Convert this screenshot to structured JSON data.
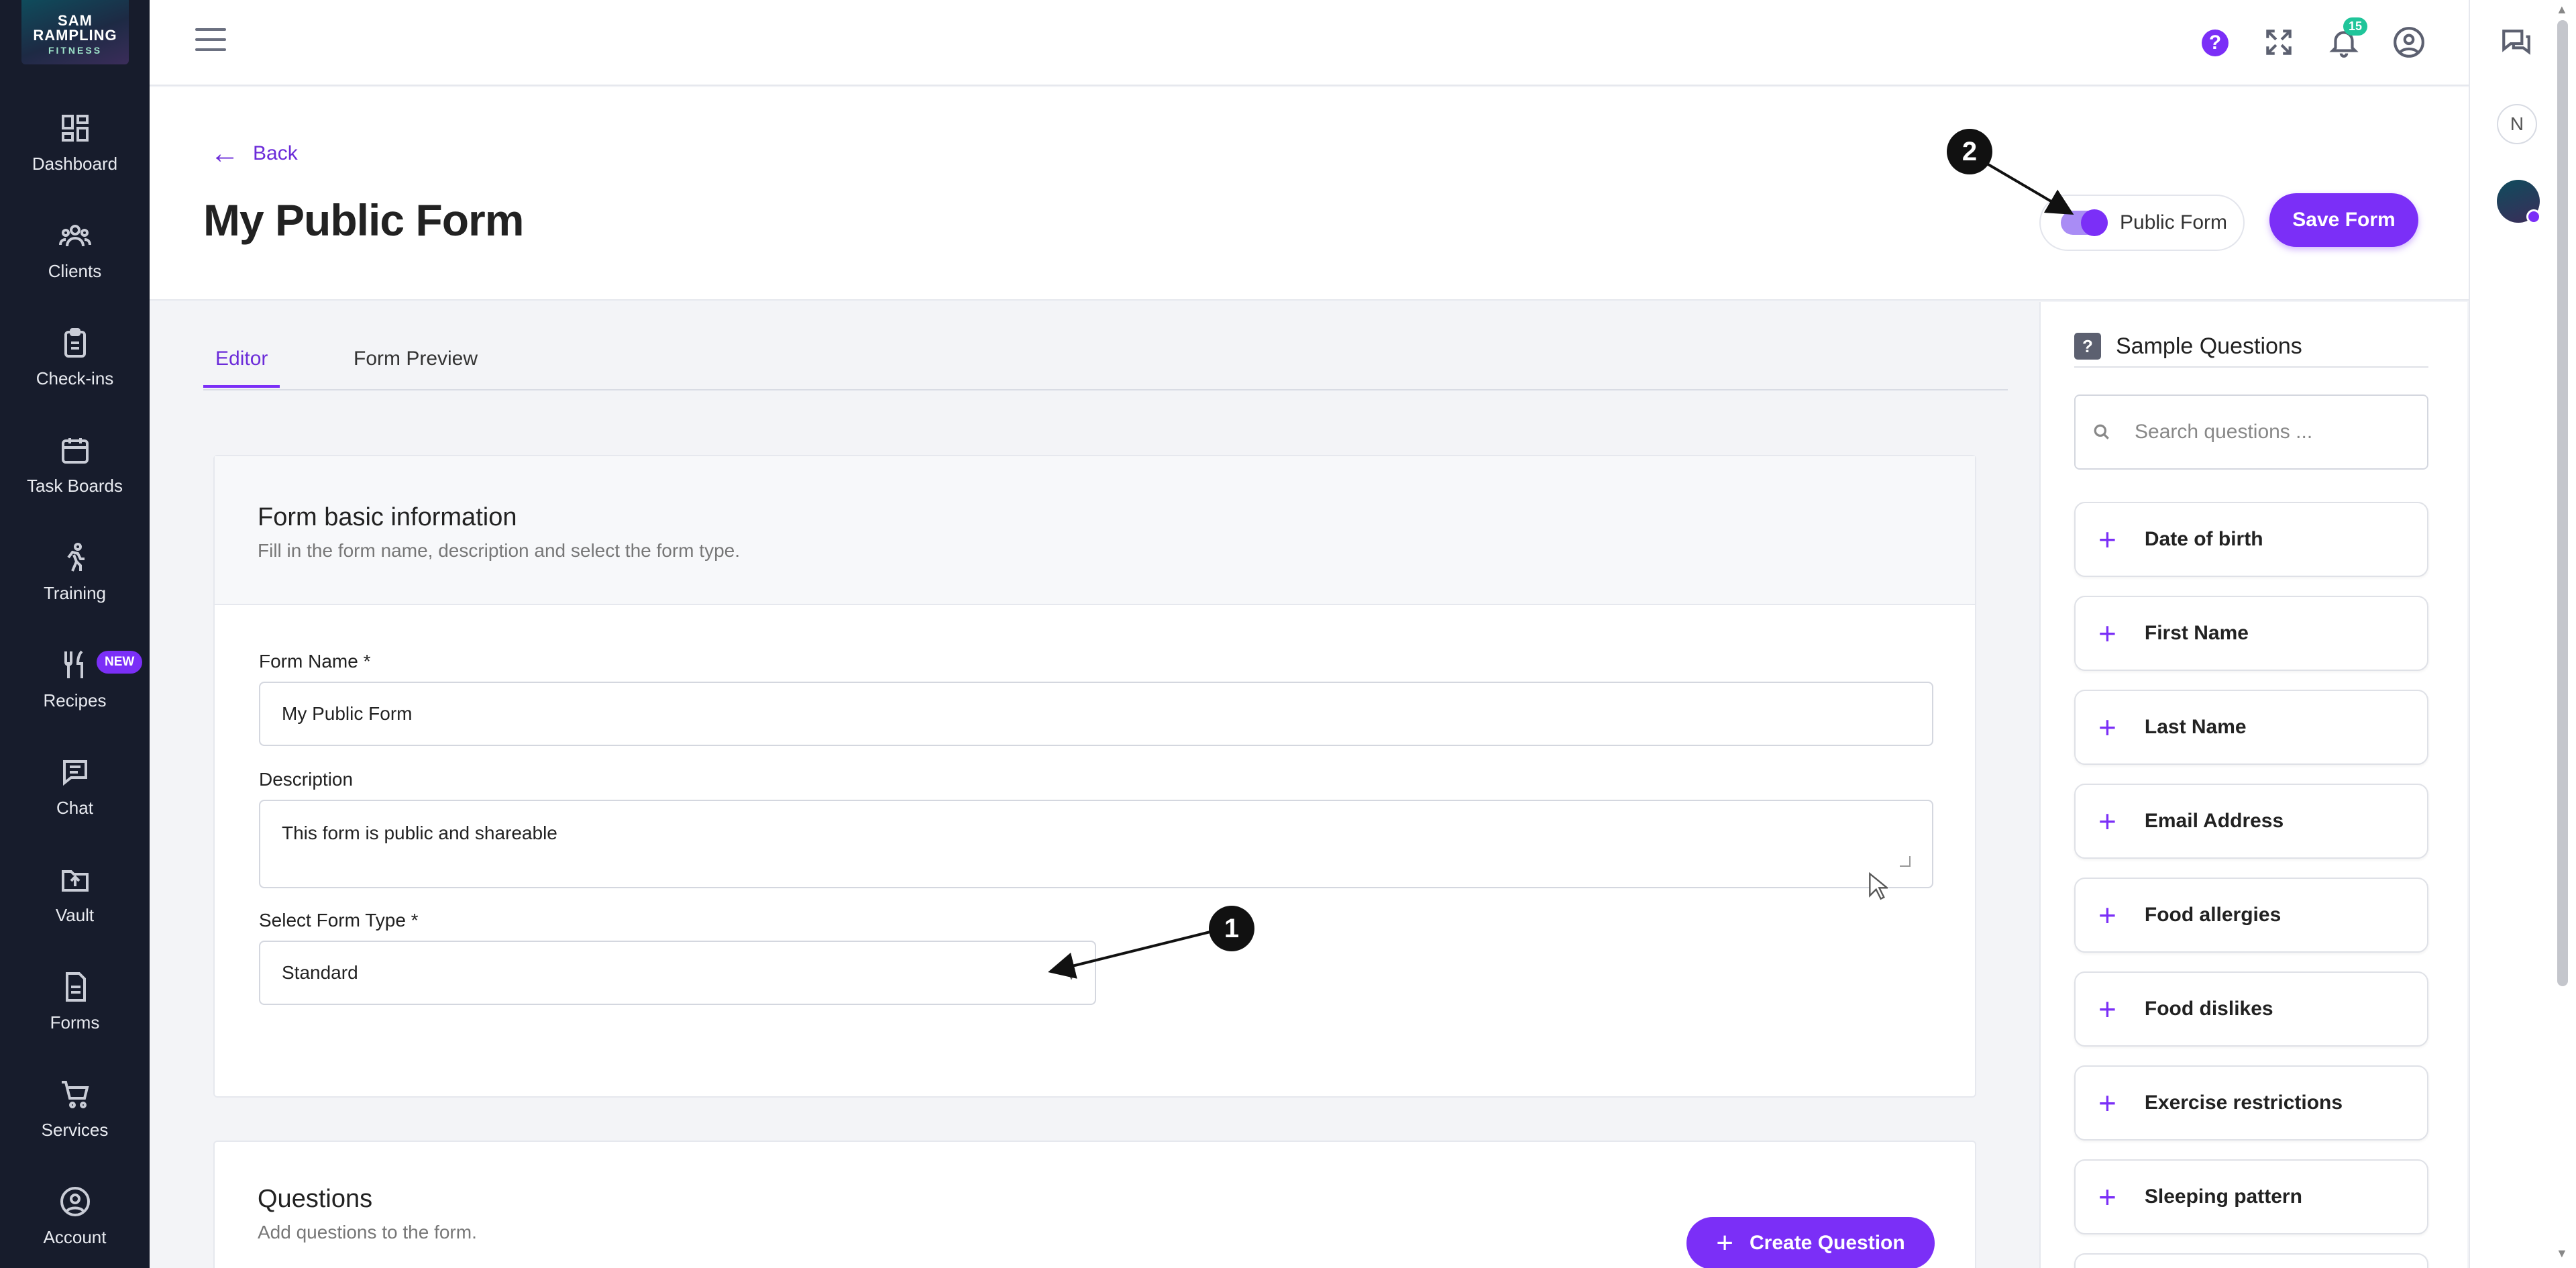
{
  "brand": {
    "line1": "SAM RAMPLING",
    "line2": "FITNESS"
  },
  "sidebar": {
    "items": [
      {
        "label": "Dashboard"
      },
      {
        "label": "Clients"
      },
      {
        "label": "Check-ins"
      },
      {
        "label": "Task Boards"
      },
      {
        "label": "Training"
      },
      {
        "label": "Recipes",
        "badge": "NEW"
      },
      {
        "label": "Chat"
      },
      {
        "label": "Vault"
      },
      {
        "label": "Forms"
      },
      {
        "label": "Services"
      },
      {
        "label": "Account"
      }
    ]
  },
  "topbar": {
    "help_label": "?",
    "notification_count": "15"
  },
  "rightstrip": {
    "avatar_initial": "N"
  },
  "page": {
    "back_label": "Back",
    "title": "My Public Form",
    "public_toggle_label": "Public Form",
    "public_toggle_on": true,
    "save_label": "Save Form"
  },
  "tabs": [
    {
      "label": "Editor",
      "active": true
    },
    {
      "label": "Form Preview",
      "active": false
    }
  ],
  "basic_info": {
    "title": "Form basic information",
    "subtitle": "Fill in the form name, description and select the form type.",
    "name_label": "Form Name *",
    "name_value": "My Public Form",
    "description_label": "Description",
    "description_value": "This form is public and shareable",
    "type_label": "Select Form Type *",
    "type_value": "Standard"
  },
  "questions": {
    "title": "Questions",
    "subtitle": "Add questions to the form.",
    "create_label": "Create Question"
  },
  "sample_questions": {
    "title": "Sample Questions",
    "search_placeholder": "Search questions ...",
    "items": [
      "Date of birth",
      "First Name",
      "Last Name",
      "Email Address",
      "Food allergies",
      "Food dislikes",
      "Exercise restrictions",
      "Sleeping pattern"
    ]
  },
  "annotations": {
    "marker1": "1",
    "marker2": "2"
  },
  "colors": {
    "accent": "#7b2ff7",
    "sidebar_bg": "#171c2c",
    "badge_green": "#20c59a"
  }
}
